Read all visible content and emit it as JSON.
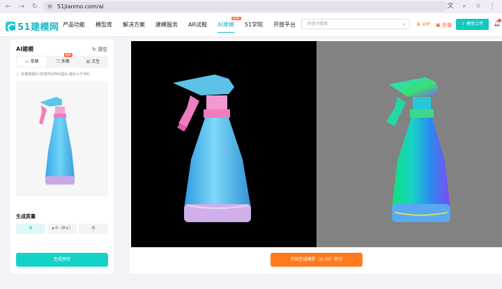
{
  "browser": {
    "url": "51jianmo.com/ai"
  },
  "header": {
    "logo_text": "51建模网",
    "nav": [
      {
        "label": "产品功能"
      },
      {
        "label": "模型库"
      },
      {
        "label": "解决方案"
      },
      {
        "label": "建模服务"
      },
      {
        "label": "AR试鞋"
      },
      {
        "label": "AI建模",
        "badge": "NEW"
      },
      {
        "label": "51学院"
      },
      {
        "label": "开放平台"
      }
    ],
    "search_placeholder": "关键词搜索",
    "vip_label": "VIP",
    "recharge_label": "充值",
    "upload_label": "模型上传"
  },
  "left_panel": {
    "title": "AI建模",
    "clear_label": "清空",
    "tabs": [
      {
        "label": "单图",
        "icon": "image-icon",
        "active": true
      },
      {
        "label": "多图",
        "icon": "multi-image-icon",
        "badge": "推荐"
      },
      {
        "label": "文生",
        "icon": "text-icon"
      }
    ],
    "hint": "多角度图片(支持JPG/PNG图片,图片小于3M)",
    "quality_label": "生成质量",
    "quality_options": [
      {
        "label": "高",
        "active": true
      },
      {
        "label": "中（默认）"
      },
      {
        "label": "低"
      }
    ],
    "generate_preview_label": "生成预览"
  },
  "main": {
    "start_label": "开始生成模型（",
    "cost": "30",
    "cost_suffix": "）积分"
  },
  "colors": {
    "accent": "#14c7c0",
    "orange": "#ff7a1f",
    "bottle_blue": "#5bc6ef",
    "trigger_pink": "#f07cc0"
  }
}
